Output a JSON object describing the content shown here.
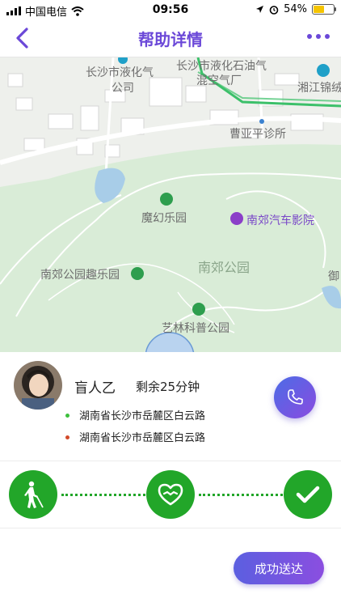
{
  "status_bar": {
    "carrier": "中国电信",
    "time": "09:56",
    "battery_percent": "54%",
    "battery_level": 0.54
  },
  "nav": {
    "title": "帮助详情"
  },
  "map": {
    "labels": {
      "gas_station_1": "长沙市液化气",
      "gas_station_1b": "公司",
      "gas_station_2": "长沙市液化石油气",
      "gas_station_2b": "混空气厂",
      "xiangjiang": "湘江锦绒",
      "clinic": "曹亚平诊所",
      "amusement": "魔幻乐园",
      "cinema": "南郊汽车影院",
      "park": "南郊公园",
      "fun_park": "南郊公园趣乐园",
      "science_park": "艺林科普公园",
      "edge": "御"
    }
  },
  "helper": {
    "name": "盲人乙",
    "remaining": "剩余25分钟",
    "from_address": "湖南省长沙市岳麓区白云路",
    "to_address": "湖南省长沙市岳麓区白云路",
    "from_color": "#3dbf3d",
    "to_color": "#d24a2a"
  },
  "progress": {
    "steps": [
      "blind-walker-icon",
      "heart-handshake-icon",
      "check-icon"
    ],
    "color": "#22a629"
  },
  "actions": {
    "success_label": "成功送达"
  }
}
